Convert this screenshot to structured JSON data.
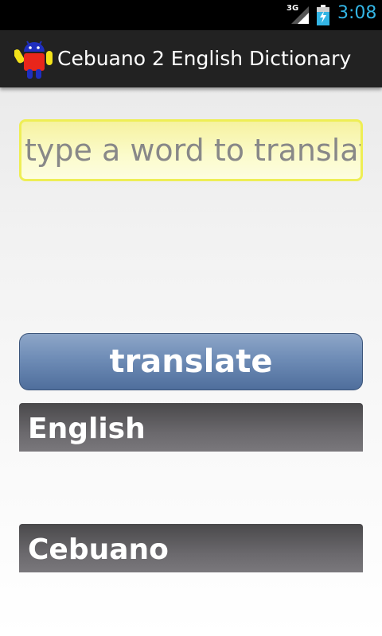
{
  "status_bar": {
    "network": "3G",
    "time": "3:08"
  },
  "action_bar": {
    "title": "Cebuano 2 English Dictionary",
    "icon": "android-robot-icon"
  },
  "input": {
    "placeholder": "type a word to translate",
    "value": ""
  },
  "translate_button": {
    "label": "translate"
  },
  "sections": {
    "english": {
      "label": "English",
      "result": ""
    },
    "cebuano": {
      "label": "Cebuano",
      "result": ""
    }
  },
  "colors": {
    "clock": "#33b5e5",
    "action_bar": "#222222",
    "input_border": "#eeee55",
    "button": "#6e8cb6",
    "section_header": "#5a595b"
  }
}
